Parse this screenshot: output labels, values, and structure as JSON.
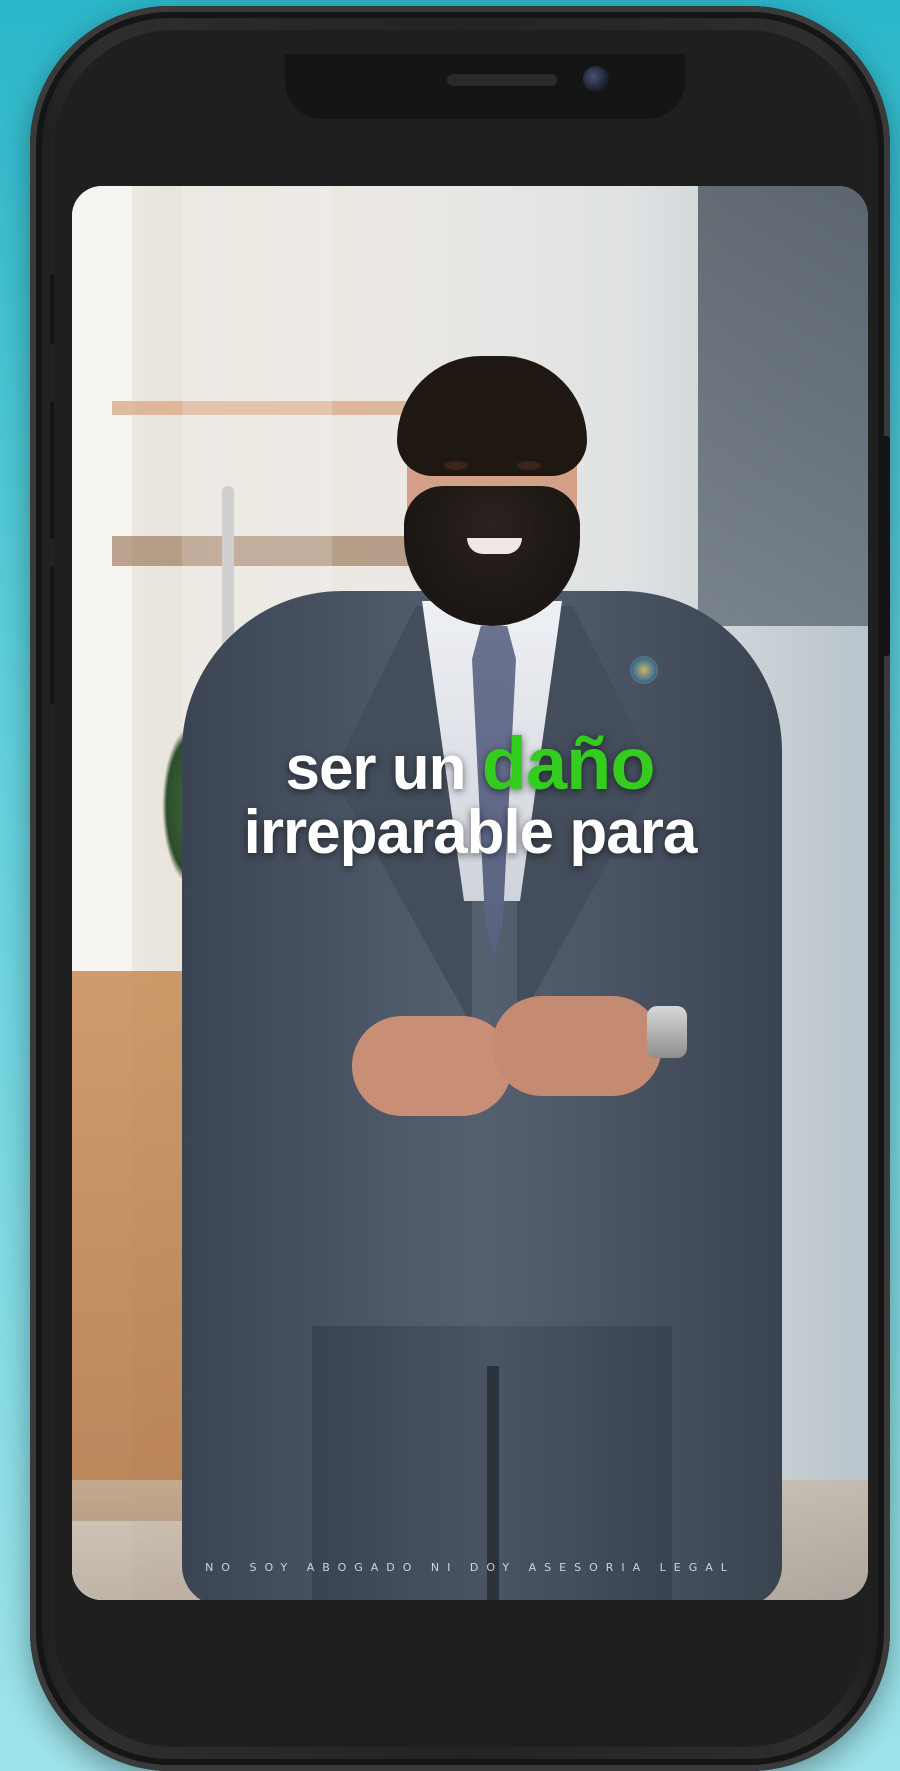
{
  "video": {
    "caption_line1_prefix": "ser un ",
    "caption_line1_highlight": "daño",
    "caption_line2": "irreparable para",
    "disclaimer": "NO SOY ABOGADO NI DOY ASESORIA LEGAL"
  },
  "colors": {
    "background_accent": "#2bb6c9",
    "caption_highlight": "#33cc1f",
    "caption_text": "#ffffff",
    "phone_frame": "#232323"
  }
}
